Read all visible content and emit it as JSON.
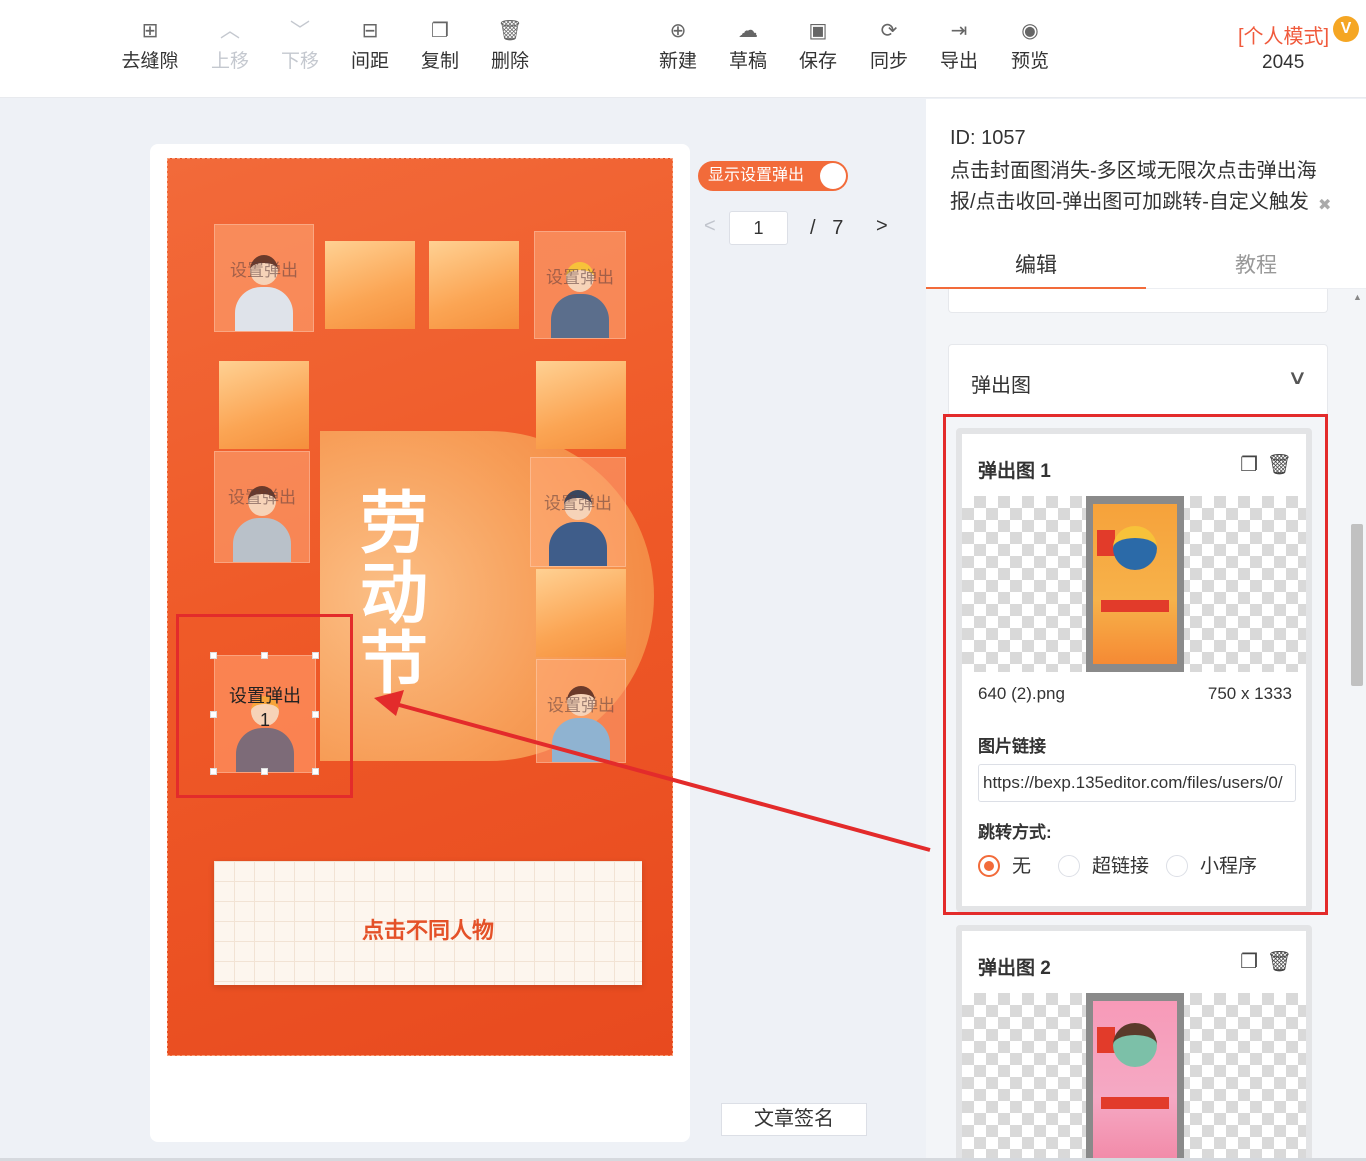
{
  "toolbar": {
    "left_tools": [
      {
        "label": "去缝隙",
        "icon": "grid-icon",
        "glyph": "⊞",
        "enabled": true
      },
      {
        "label": "上移",
        "icon": "chevron-up-icon",
        "glyph": "︿",
        "enabled": false
      },
      {
        "label": "下移",
        "icon": "chevron-down-icon",
        "glyph": "﹀",
        "enabled": false
      },
      {
        "label": "间距",
        "icon": "spacing-icon",
        "glyph": "⊟",
        "enabled": true
      },
      {
        "label": "复制",
        "icon": "copy-icon",
        "glyph": "❐",
        "enabled": true
      },
      {
        "label": "删除",
        "icon": "trash-icon",
        "glyph": "🗑",
        "enabled": true
      }
    ],
    "right_tools": [
      {
        "label": "新建",
        "icon": "new-file-icon",
        "glyph": "⊕"
      },
      {
        "label": "草稿",
        "icon": "cloud-icon",
        "glyph": "☁"
      },
      {
        "label": "保存",
        "icon": "save-icon",
        "glyph": "▣"
      },
      {
        "label": "同步",
        "icon": "sync-icon",
        "glyph": "⟳"
      },
      {
        "label": "导出",
        "icon": "export-icon",
        "glyph": "⇥"
      },
      {
        "label": "预览",
        "icon": "eye-icon",
        "glyph": "◉"
      }
    ],
    "mode_label": "[个人模式]",
    "mode_badge": "V",
    "count": "2045"
  },
  "canvas": {
    "title": "劳动节",
    "cta": "点击不同人物",
    "person_label": "设置弹出",
    "selected_label": "设置弹出\n1",
    "colors": {
      "accent": "#f26b3a",
      "highlight": "#e32b2b"
    }
  },
  "controls": {
    "toggle_label": "显示设置弹出",
    "page_current": "1",
    "page_sep": "/",
    "page_total": "7",
    "sign_button": "文章签名"
  },
  "panel": {
    "id_text": "ID: 1057",
    "description": "点击封面图消失-多区域无限次点击弹出海报/点击收回-弹出图可加跳转-自定义触发",
    "tabs": [
      "编辑",
      "教程"
    ],
    "section_title": "弹出图",
    "popups": [
      {
        "title": "弹出图 1",
        "file_name": "640 (2).png",
        "dims": "750 x 1333",
        "link_label": "图片链接",
        "link_value": "https://bexp.135editor.com/files/users/0/",
        "jump_label": "跳转方式:",
        "options": [
          "无",
          "超链接",
          "小程序"
        ],
        "selected_option": "无"
      },
      {
        "title": "弹出图 2"
      }
    ]
  }
}
